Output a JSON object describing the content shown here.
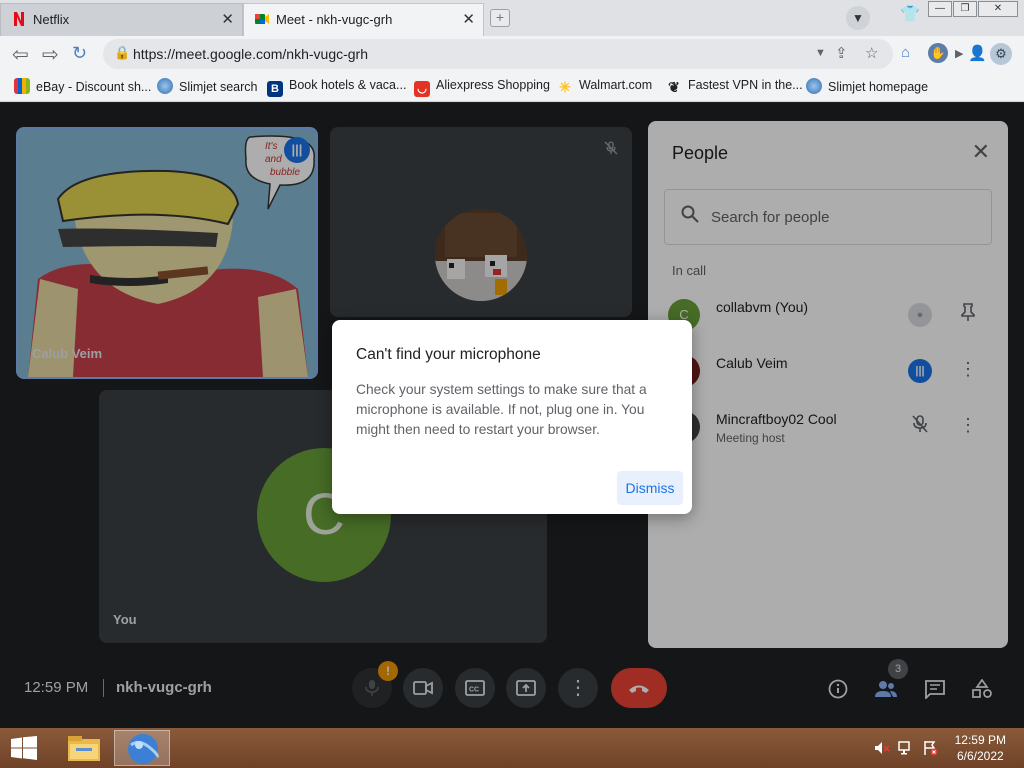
{
  "tabs": [
    {
      "title": "Netflix",
      "icon": "netflix-icon"
    },
    {
      "title": "Meet - nkh-vugc-grh",
      "icon": "google-meet-icon"
    }
  ],
  "toolbar": {
    "url": "https://meet.google.com/nkh-vugc-grh"
  },
  "bookmarks": [
    {
      "label": "eBay - Discount sh...",
      "icon": "ebay-icon"
    },
    {
      "label": "Slimjet search",
      "icon": "globe-icon"
    },
    {
      "label": "Book hotels & vaca...",
      "icon": "booking-icon"
    },
    {
      "label": "Aliexpress Shopping",
      "icon": "aliexpress-icon"
    },
    {
      "label": "Walmart.com",
      "icon": "walmart-icon"
    },
    {
      "label": "Fastest VPN in the...",
      "icon": "vpn-icon"
    },
    {
      "label": "Slimjet homepage",
      "icon": "globe-icon"
    }
  ],
  "tiles": {
    "calub": {
      "name": "Calub Veim",
      "bubble_text": "It's\nand\nbubble"
    },
    "you": {
      "name": "You",
      "initial": "C"
    }
  },
  "people_panel": {
    "title": "People",
    "search_placeholder": "Search for people",
    "section_label": "In call",
    "participants": [
      {
        "name": "collabvm (You)",
        "initial": "C",
        "color": "#689f38",
        "subtitle": ""
      },
      {
        "name": "Calub Veim",
        "initial": "",
        "color": "#7a1c1c",
        "subtitle": ""
      },
      {
        "name": "Mincraftboy02 Cool",
        "initial": "",
        "color": "#444444",
        "subtitle": "Meeting host"
      }
    ]
  },
  "bottom_bar": {
    "time": "12:59 PM",
    "meeting_code": "nkh-vugc-grh",
    "participant_count": "3",
    "mic_warning": "!"
  },
  "dialog": {
    "title": "Can't find your microphone",
    "body": "Check your system settings to make sure that a microphone is available. If not, plug one in. You might then need to restart your browser.",
    "dismiss_label": "Dismiss"
  },
  "taskbar": {
    "time": "12:59 PM",
    "date": "6/6/2022"
  },
  "colors": {
    "meet_bg": "#202124",
    "accent_blue": "#1a73e8",
    "hangup_red": "#ea4335",
    "you_avatar_green": "#689f38"
  }
}
